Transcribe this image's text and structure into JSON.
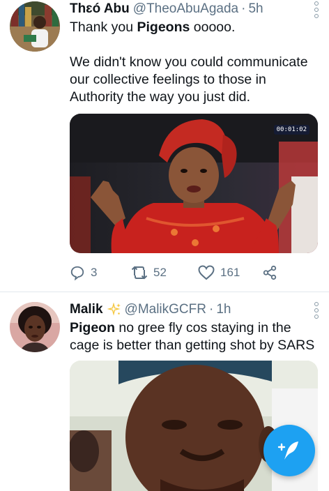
{
  "tweets": [
    {
      "name": "Thɛó Abu",
      "handle": "@TheoAbuAgada",
      "separator": "·",
      "time": "5h",
      "text_line1_pre": "Thank you ",
      "text_line1_bold": "Pigeons",
      "text_line1_post": " ooooo.",
      "text_para2": "We didn't know you could communicate our collective feelings to those in Authority the way you just did.",
      "media_badge": "00:01:02",
      "replies": "3",
      "retweets": "52",
      "likes": "161"
    },
    {
      "name": "Malik",
      "verified_emoji": "sparkles-icon",
      "handle": "@MalikGCFR",
      "separator": "·",
      "time": "1h",
      "text_bold": "Pigeon",
      "text_post": " no gree fly cos staying in the cage is better than getting shot by SARS"
    }
  ],
  "colors": {
    "accent": "#1da1f2",
    "secondary_text": "#5b7083",
    "divider": "#e1e8ed"
  },
  "fab": {
    "icon": "compose-tweet-icon"
  }
}
